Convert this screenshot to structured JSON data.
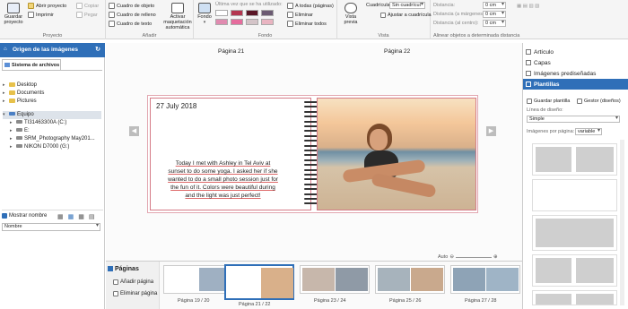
{
  "ribbon": {
    "project": {
      "save": "Guardar proyecto",
      "open": "Abrir proyecto",
      "print": "Imprimir",
      "copy": "Copiar",
      "paste": "Pegar",
      "title": "Proyecto"
    },
    "add": {
      "object_box": "Cuadro de objeto",
      "fill_box": "Cuadro de relleno",
      "text_box": "Cuadro de texto",
      "auto_layout": "Activar maquetación automática",
      "title": "Añadir"
    },
    "background": {
      "fondo": "Fondo",
      "last_used": "Última vez que se ha utilizado:",
      "swatches": [
        "#ffffff",
        "#b3364f",
        "#5a1727",
        "#6b5b72",
        "#e08bb0",
        "#e66c9d",
        "#d4c4c8",
        "#e9b4c1"
      ],
      "all": "A todas (páginas)",
      "delete": "Eliminar",
      "delete_all": "Eliminar todos",
      "title": "Fondo"
    },
    "view": {
      "preview": "Vista previa",
      "grid_label": "Cuadrícula:",
      "grid_value": "Sin cuadrícul",
      "snap": "Ajustar a cuadrícula",
      "title": "Vista"
    },
    "align": {
      "dist1": "Distancia:",
      "dist2": "Distancia (a márgenes):",
      "dist3": "Distancia (al centro):",
      "value": "0 cm",
      "title": "Alinear objetos a determinada distancia"
    }
  },
  "left_panel": {
    "header": "Origen de las imágenes",
    "tab": "Sistema de archivos",
    "tree": [
      {
        "label": "Desktop",
        "type": "folder"
      },
      {
        "label": "Documents",
        "type": "folder"
      },
      {
        "label": "Pictures",
        "type": "folder"
      },
      {
        "label": "Equipo",
        "type": "computer"
      },
      {
        "label": "TI31463300A (C:)",
        "type": "drive"
      },
      {
        "label": "E:",
        "type": "drive"
      },
      {
        "label": "SRM_Photography May201...",
        "type": "drive"
      },
      {
        "label": "NIKON D7000 (G:)",
        "type": "drive"
      }
    ],
    "show_name": "Mostrar nombre",
    "sort": "Nombre"
  },
  "canvas": {
    "page_left": "Página 21",
    "page_right": "Página 22",
    "date": "27 July 2018",
    "body_text": "Today I met with Ashley in Tel Aviv at sunset to do some yoga. I asked her if she wanted to do a small photo session just for the fun of it. Colors were beautiful during and the light was just perfect!",
    "zoom_label": "Auto"
  },
  "bottom": {
    "title": "Páginas",
    "add_page": "Añadir página",
    "delete_page": "Eliminar página",
    "thumbs": [
      "Página 19 / 20",
      "Página 21 / 22",
      "Página 23 / 24",
      "Página 25 / 26",
      "Página 27 / 28"
    ]
  },
  "right_panel": {
    "items": [
      "Artículo",
      "Capas",
      "Imágenes prediseñadas",
      "Plantillas"
    ],
    "save_template": "Guardar plantilla",
    "manager": "Gestor (diseños)",
    "design_line": "Línea de diseño:",
    "design_value": "Simple",
    "images_per_page": "Imágenes por página:",
    "images_value": "variable"
  }
}
